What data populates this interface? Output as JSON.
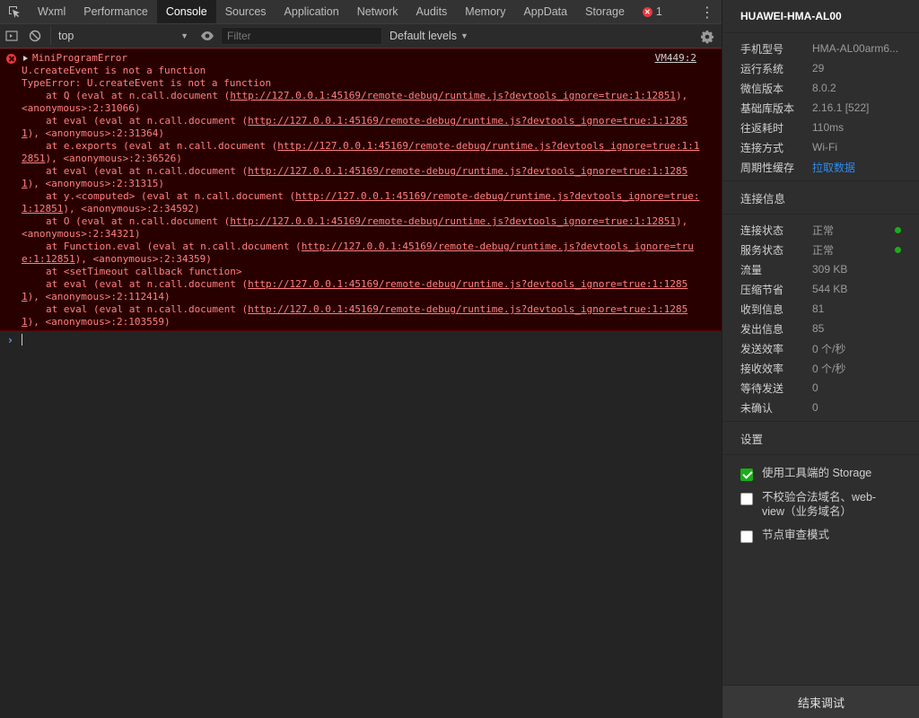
{
  "tabs": [
    "Wxml",
    "Performance",
    "Console",
    "Sources",
    "Application",
    "Network",
    "Audits",
    "Memory",
    "AppData",
    "Storage"
  ],
  "active_tab": "Console",
  "error_count": "1",
  "toolbar": {
    "context": "top",
    "filter_placeholder": "Filter",
    "levels": "Default levels"
  },
  "console": {
    "error_title": "MiniProgramError",
    "source": "VM449:2",
    "lines": [
      {
        "text": "U.createEvent is not a function"
      },
      {
        "text": "TypeError: U.createEvent is not a function"
      },
      {
        "pre": "at Q (eval at n.call.document (",
        "url": "http://127.0.0.1:45169/remote-debug/runtime.js?devtools_ignore=true:1:12851",
        "post": "),",
        "indent": true
      },
      {
        "text": "<anonymous>:2:31066)"
      },
      {
        "pre": "at eval (eval at n.call.document (",
        "url": "http://127.0.0.1:45169/remote-debug/runtime.js?devtools_ignore=true:1:1285",
        "post": "",
        "indent": true
      },
      {
        "pre": "",
        "url": "1",
        "post": "), <anonymous>:2:31364)"
      },
      {
        "pre": "at e.exports (eval at n.call.document (",
        "url": "http://127.0.0.1:45169/remote-debug/runtime.js?devtools_ignore=true:1:1",
        "post": "",
        "indent": true
      },
      {
        "pre": "",
        "url": "2851",
        "post": "), <anonymous>:2:36526)"
      },
      {
        "pre": "at eval (eval at n.call.document (",
        "url": "http://127.0.0.1:45169/remote-debug/runtime.js?devtools_ignore=true:1:1285",
        "post": "",
        "indent": true
      },
      {
        "pre": "",
        "url": "1",
        "post": "), <anonymous>:2:31315)"
      },
      {
        "pre": "at y.<computed> (eval at n.call.document (",
        "url": "http://127.0.0.1:45169/remote-debug/runtime.js?devtools_ignore=true:",
        "post": "",
        "indent": true
      },
      {
        "pre": "",
        "url": "1:12851",
        "post": "), <anonymous>:2:34592)"
      },
      {
        "pre": "at O (eval at n.call.document (",
        "url": "http://127.0.0.1:45169/remote-debug/runtime.js?devtools_ignore=true:1:12851",
        "post": "),",
        "indent": true
      },
      {
        "text": "<anonymous>:2:34321)"
      },
      {
        "pre": "at Function.eval (eval at n.call.document (",
        "url": "http://127.0.0.1:45169/remote-debug/runtime.js?devtools_ignore=tru",
        "post": "",
        "indent": true
      },
      {
        "pre": "",
        "url": "e:1:12851",
        "post": "), <anonymous>:2:34359)"
      },
      {
        "text": "at <setTimeout callback function>",
        "indent": true
      },
      {
        "pre": "at eval (eval at n.call.document (",
        "url": "http://127.0.0.1:45169/remote-debug/runtime.js?devtools_ignore=true:1:1285",
        "post": "",
        "indent": true
      },
      {
        "pre": "",
        "url": "1",
        "post": "), <anonymous>:2:112414)"
      },
      {
        "pre": "at eval (eval at n.call.document (",
        "url": "http://127.0.0.1:45169/remote-debug/runtime.js?devtools_ignore=true:1:1285",
        "post": "",
        "indent": true
      },
      {
        "pre": "",
        "url": "1",
        "post": "), <anonymous>:2:103559)"
      }
    ]
  },
  "side": {
    "device": "HUAWEI-HMA-AL00",
    "info": [
      {
        "k": "手机型号",
        "v": "HMA-AL00arm6..."
      },
      {
        "k": "运行系统",
        "v": "29"
      },
      {
        "k": "微信版本",
        "v": "8.0.2"
      },
      {
        "k": "基础库版本",
        "v": "2.16.1 [522]"
      },
      {
        "k": "往返耗时",
        "v": "110ms"
      },
      {
        "k": "连接方式",
        "v": "Wi-Fi"
      },
      {
        "k": "周期性缓存",
        "v": "拉取数据",
        "link": true
      }
    ],
    "conn_title": "连接信息",
    "conn": [
      {
        "k": "连接状态",
        "v": "正常",
        "status": "#1aad19"
      },
      {
        "k": "服务状态",
        "v": "正常",
        "status": "#1aad19"
      },
      {
        "k": "流量",
        "v": "309 KB"
      },
      {
        "k": "压缩节省",
        "v": "544 KB"
      },
      {
        "k": "收到信息",
        "v": "81"
      },
      {
        "k": "发出信息",
        "v": "85"
      },
      {
        "k": "发送效率",
        "v": "0 个/秒"
      },
      {
        "k": "接收效率",
        "v": "0 个/秒"
      },
      {
        "k": "等待发送",
        "v": "0"
      },
      {
        "k": "未确认",
        "v": "0"
      }
    ],
    "settings_title": "设置",
    "settings": [
      {
        "label": "使用工具端的 Storage",
        "checked": true
      },
      {
        "label": "不校验合法域名、web-view（业务域名）",
        "checked": false
      },
      {
        "label": "节点审查模式",
        "checked": false
      }
    ],
    "end_button": "结束调试"
  }
}
